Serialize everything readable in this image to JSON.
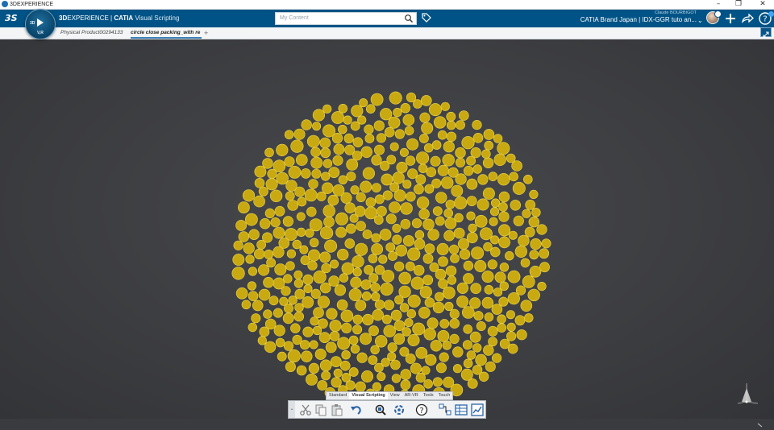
{
  "window": {
    "title": "3DEXPERIENCE",
    "controls": [
      "minimize-icon",
      "restore-icon",
      "close-icon"
    ]
  },
  "topbar": {
    "brand_3d": "3D",
    "brand_experience": "EXPERIENCE",
    "brand_separator": " | ",
    "product": "CATIA",
    "app": "Visual Scripting",
    "search_placeholder": "My Content",
    "user_name": "Claude BOURBIGOT",
    "tenant": "CATIA Brand Japan | IDX-GGR tuto an...",
    "icons": [
      "ds-logo-icon",
      "search-icon",
      "tag-icon",
      "chevron-down-icon",
      "plus-icon",
      "share-icon",
      "help-icon"
    ],
    "bg_color": "#005386"
  },
  "compass": {
    "labels": [
      "3D",
      "V,R"
    ]
  },
  "tabs": {
    "items": [
      {
        "label": "Physical Product00294133"
      },
      {
        "label": "circle close packing_with re"
      }
    ],
    "add_label": "+"
  },
  "viewport": {
    "circle_color": "#c9a912",
    "circle_stroke": "#eed84a",
    "background": "#3d3e41"
  },
  "actionbar": {
    "tabs": [
      {
        "label": "Standard"
      },
      {
        "label": "Visual Scripting"
      },
      {
        "label": "View"
      },
      {
        "label": "AR-VR"
      },
      {
        "label": "Tools"
      },
      {
        "label": "Touch"
      }
    ],
    "active_tab": "Visual Scripting",
    "icons": [
      "cut-icon",
      "copy-icon",
      "paste-icon",
      "undo-icon",
      "fit-all-icon",
      "update-icon",
      "help-icon",
      "graph-icon",
      "table-icon",
      "chart-icon"
    ]
  }
}
